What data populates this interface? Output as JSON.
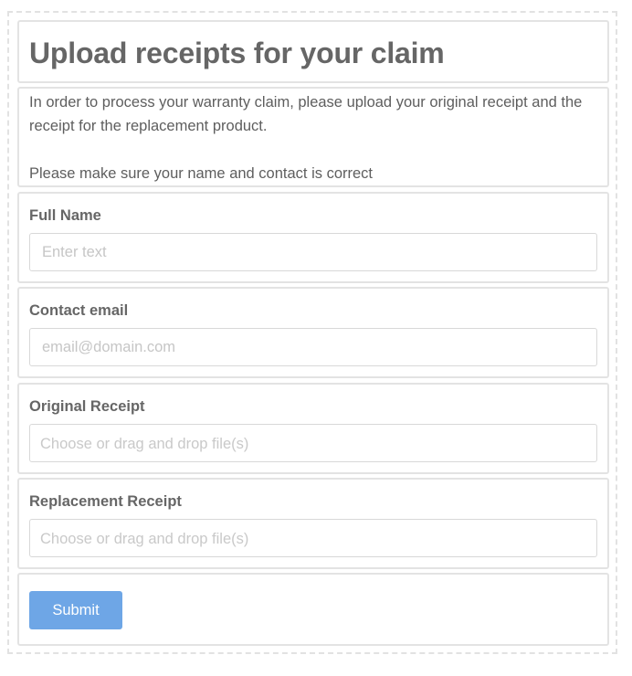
{
  "form": {
    "title": "Upload receipts for your claim",
    "intro": {
      "line1": "In order to process your warranty claim, please upload your original receipt and the receipt for the replacement product.",
      "line2": "Please make sure your name and contact is correct"
    },
    "fields": {
      "full_name": {
        "label": "Full Name",
        "placeholder": "Enter text",
        "value": ""
      },
      "contact_email": {
        "label": "Contact email",
        "placeholder": "email@domain.com",
        "value": ""
      },
      "original_receipt": {
        "label": "Original Receipt",
        "placeholder": "Choose or drag and drop file(s)"
      },
      "replacement_receipt": {
        "label": "Replacement Receipt",
        "placeholder": "Choose or drag and drop file(s)"
      }
    },
    "submit_label": "Submit"
  },
  "colors": {
    "submit_button": "#6ea6e6",
    "border": "#e3e3e3",
    "text": "#5f5f5f",
    "placeholder": "#c6c6c6"
  }
}
